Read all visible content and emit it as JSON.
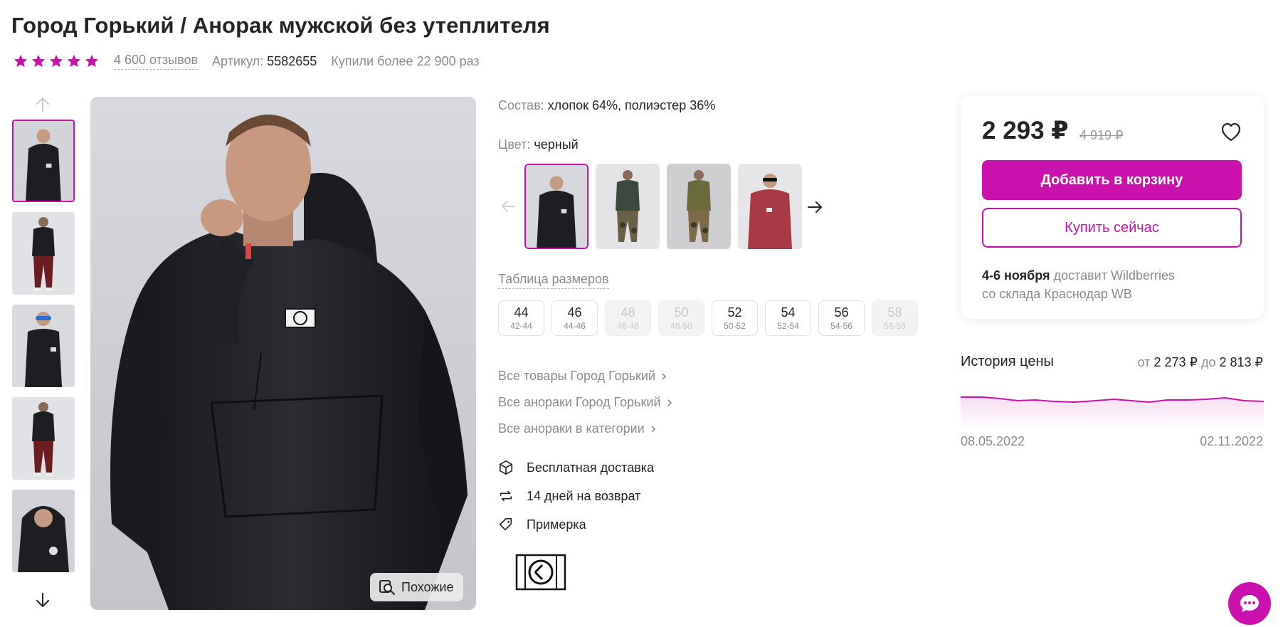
{
  "product": {
    "title": "Город Горький / Анорак мужской без утеплителя",
    "rating_stars": 5,
    "reviews": "4 600 отзывов",
    "article_label": "Артикул:",
    "article": "5582655",
    "bought": "Купили более 22 900 раз"
  },
  "gallery": {
    "similar_label": "Похожие",
    "thumbnails": [
      "thumb-front-hood",
      "thumb-full-dark-pants",
      "thumb-sunglasses",
      "thumb-full-hood",
      "thumb-closeup"
    ],
    "active_thumbnail": 0
  },
  "details": {
    "composition_label": "Состав:",
    "composition": "хлопок 64%, полиэстер 36%",
    "color_label": "Цвет:",
    "color": "черный",
    "colors": [
      "black",
      "green-camo",
      "olive-camo",
      "red"
    ],
    "active_color": 0,
    "size_table_label": "Таблица размеров",
    "sizes": [
      {
        "n": "44",
        "r": "42-44",
        "available": true
      },
      {
        "n": "46",
        "r": "44-46",
        "available": true
      },
      {
        "n": "48",
        "r": "46-48",
        "available": false
      },
      {
        "n": "50",
        "r": "48-50",
        "available": false
      },
      {
        "n": "52",
        "r": "50-52",
        "available": true
      },
      {
        "n": "54",
        "r": "52-54",
        "available": true
      },
      {
        "n": "56",
        "r": "54-56",
        "available": true
      },
      {
        "n": "58",
        "r": "56-58",
        "available": false
      }
    ],
    "links": [
      "Все товары Город Горький",
      "Все анораки Город Горький",
      "Все анораки в категории"
    ],
    "features": [
      "Бесплатная доставка",
      "14 дней на возврат",
      "Примерка"
    ]
  },
  "buy": {
    "price": "2 293 ₽",
    "old_price": "4 919 ₽",
    "add_to_cart": "Добавить в корзину",
    "buy_now": "Купить сейчас",
    "delivery_date": "4-6 ноября",
    "delivery_by": "доставит Wildberries",
    "delivery_from": "со склада Краснодар WB"
  },
  "price_history": {
    "title": "История цены",
    "from_label": "от",
    "min": "2 273 ₽",
    "to_label": "до",
    "max": "2 813 ₽",
    "date_start": "08.05.2022",
    "date_end": "02.11.2022"
  },
  "colors": {
    "accent": "#cb11ab"
  },
  "icons": [
    "arrow-up-icon",
    "arrow-down-icon",
    "heart-icon",
    "box-icon",
    "return-icon",
    "tag-icon",
    "search-similar-icon",
    "chat-icon"
  ]
}
